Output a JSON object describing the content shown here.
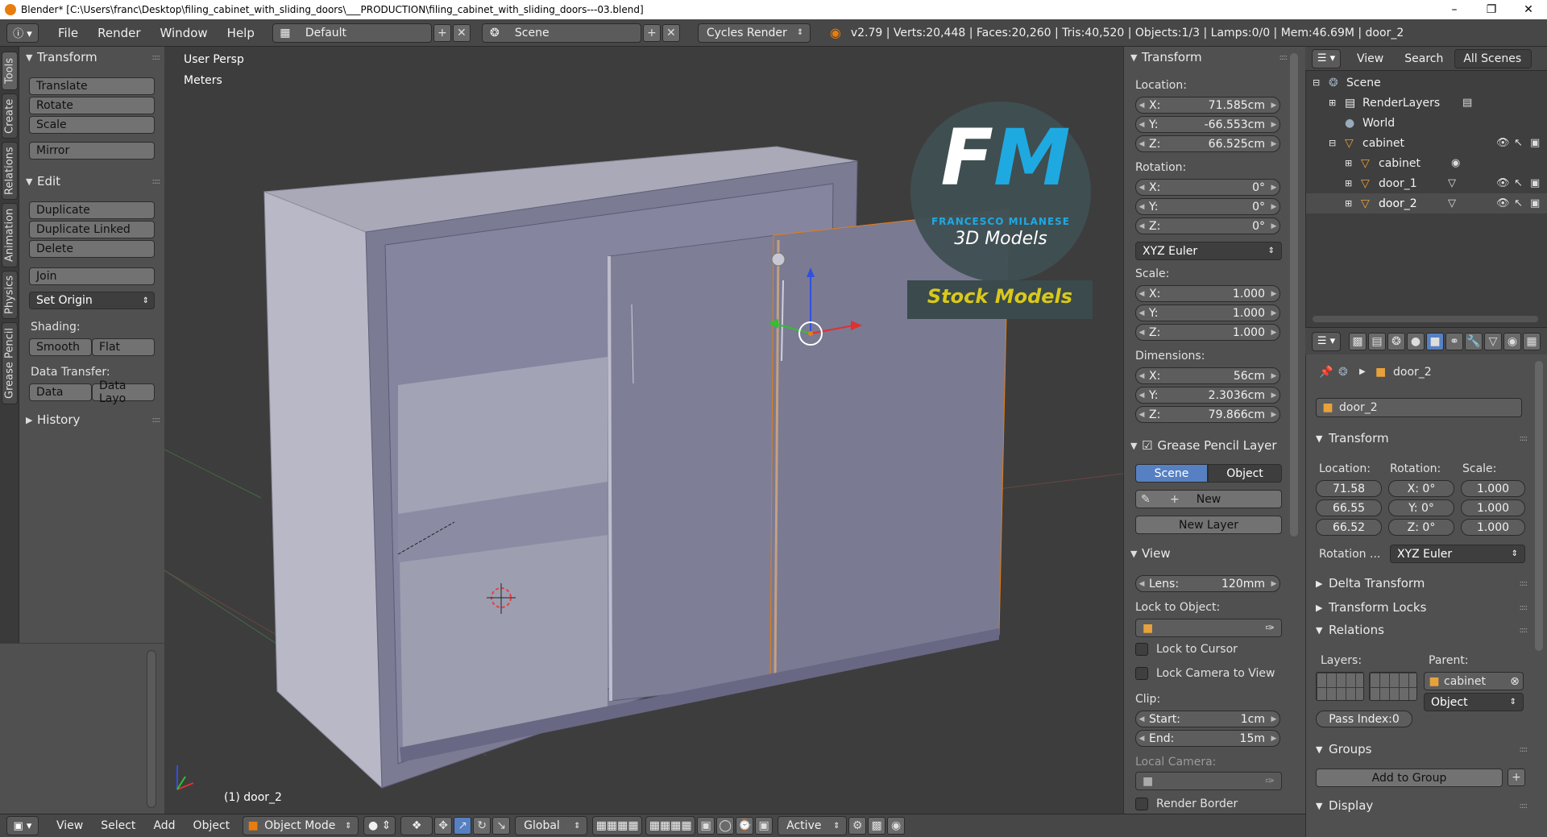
{
  "window": {
    "title": "Blender* [C:\\Users\\franc\\Desktop\\filing_cabinet_with_sliding_doors\\___PRODUCTION\\filing_cabinet_with_sliding_doors---03.blend]"
  },
  "infobar": {
    "menus": [
      "File",
      "Render",
      "Window",
      "Help"
    ],
    "layout": "Default",
    "scene": "Scene",
    "engine": "Cycles Render",
    "stats": "v2.79 | Verts:20,448 | Faces:20,260 | Tris:40,520 | Objects:1/3 | Lamps:0/0 | Mem:46.69M | door_2"
  },
  "left_tabs": [
    "Tools",
    "Create",
    "Relations",
    "Animation",
    "Physics",
    "Grease Pencil"
  ],
  "toolshelf": {
    "transform_title": "Transform",
    "transform_buttons": [
      "Translate",
      "Rotate",
      "Scale",
      "Mirror"
    ],
    "edit_title": "Edit",
    "edit_buttons": [
      "Duplicate",
      "Duplicate Linked",
      "Delete",
      "Join"
    ],
    "set_origin": "Set Origin",
    "shading_label": "Shading:",
    "shading_buttons": [
      "Smooth",
      "Flat"
    ],
    "data_transfer_label": "Data Transfer:",
    "data_transfer_buttons": [
      "Data",
      "Data Layo"
    ],
    "history_title": "History"
  },
  "viewport": {
    "view_name": "User Persp",
    "units": "Meters",
    "active_object_label": "(1) door_2",
    "watermark": {
      "initials_f": "F",
      "initials_m": "M",
      "name": "FRANCESCO MILANESE",
      "tagline": "3D Models",
      "banner": "Stock Models"
    }
  },
  "viewport_header": {
    "menus": [
      "View",
      "Select",
      "Add",
      "Object"
    ],
    "mode": "Object Mode",
    "orientation": "Global",
    "pivot": "Active"
  },
  "npanel": {
    "transform_title": "Transform",
    "location_label": "Location:",
    "location": [
      {
        "k": "X:",
        "v": "71.585cm"
      },
      {
        "k": "Y:",
        "v": "-66.553cm"
      },
      {
        "k": "Z:",
        "v": "66.525cm"
      }
    ],
    "rotation_label": "Rotation:",
    "rotation": [
      {
        "k": "X:",
        "v": "0°"
      },
      {
        "k": "Y:",
        "v": "0°"
      },
      {
        "k": "Z:",
        "v": "0°"
      }
    ],
    "rotation_mode": "XYZ Euler",
    "scale_label": "Scale:",
    "scale": [
      {
        "k": "X:",
        "v": "1.000"
      },
      {
        "k": "Y:",
        "v": "1.000"
      },
      {
        "k": "Z:",
        "v": "1.000"
      }
    ],
    "dimensions_label": "Dimensions:",
    "dimensions": [
      {
        "k": "X:",
        "v": "56cm"
      },
      {
        "k": "Y:",
        "v": "2.3036cm"
      },
      {
        "k": "Z:",
        "v": "79.866cm"
      }
    ],
    "gp_layer_title": "Grease Pencil Layer",
    "gp_tabs": [
      "Scene",
      "Object"
    ],
    "gp_new": "New",
    "gp_new_layer": "New Layer",
    "view_title": "View",
    "lens_label": "Lens:",
    "lens_value": "120mm",
    "lock_to_object_label": "Lock to Object:",
    "lock_to_cursor": "Lock to Cursor",
    "lock_camera": "Lock Camera to View",
    "clip_label": "Clip:",
    "clip_start_k": "Start:",
    "clip_start_v": "1cm",
    "clip_end_k": "End:",
    "clip_end_v": "15m",
    "local_camera_label": "Local Camera:",
    "render_border": "Render Border"
  },
  "outliner": {
    "header_items": [
      "View",
      "Search",
      "All Scenes"
    ],
    "rows": [
      {
        "name": "Scene",
        "indent": 0
      },
      {
        "name": "RenderLayers",
        "indent": 1
      },
      {
        "name": "World",
        "indent": 1
      },
      {
        "name": "cabinet",
        "indent": 1
      },
      {
        "name": "cabinet",
        "indent": 2
      },
      {
        "name": "door_1",
        "indent": 2
      },
      {
        "name": "door_2",
        "indent": 2
      }
    ]
  },
  "properties": {
    "object_path": "door_2",
    "object_name": "door_2",
    "transform_title": "Transform",
    "location_label": "Location:",
    "rotation_label": "Rotation:",
    "scale_label": "Scale:",
    "location": [
      "71.58",
      "66.55",
      "66.52"
    ],
    "rotation": [
      {
        "k": "X:",
        "v": "0°"
      },
      {
        "k": "Y:",
        "v": "0°"
      },
      {
        "k": "Z:",
        "v": "0°"
      }
    ],
    "scale": [
      "1.000",
      "1.000",
      "1.000"
    ],
    "rotation_mode_label": "Rotation ...",
    "rotation_mode": "XYZ Euler",
    "delta_transform": "Delta Transform",
    "transform_locks": "Transform Locks",
    "relations_title": "Relations",
    "layers_label": "Layers:",
    "parent_label": "Parent:",
    "parent_value": "cabinet",
    "parent_type": "Object",
    "pass_index": "Pass Index:0",
    "groups_title": "Groups",
    "add_to_group": "Add to Group",
    "display_title": "Display"
  },
  "colors": {
    "accent_blue": "#5680c2",
    "orange": "#e87d0d",
    "fm_cyan": "#1fa9e1",
    "fm_yellow": "#d9c91a"
  }
}
